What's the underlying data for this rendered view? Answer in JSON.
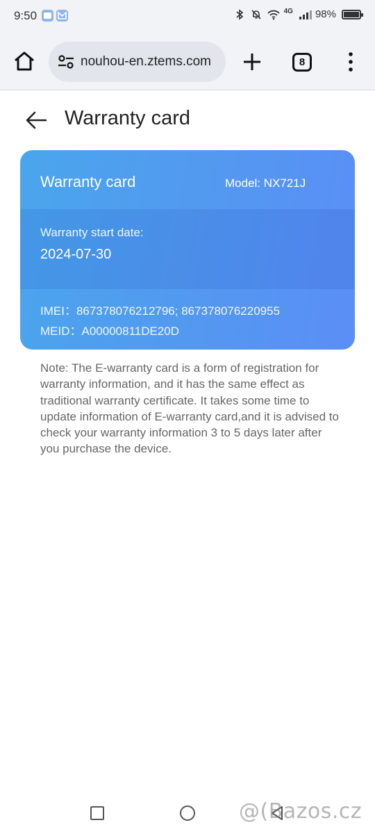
{
  "status_bar": {
    "time": "9:50",
    "network": "4G",
    "battery": "98%"
  },
  "browser": {
    "url": "nouhou-en.ztems.com",
    "tab_count": "8",
    "icons": [
      "home-icon",
      "site-settings-icon",
      "plus-icon",
      "tabs-icon",
      "more-vert-icon"
    ]
  },
  "page": {
    "title": "Warranty card"
  },
  "card": {
    "title": "Warranty card",
    "model": "Model: NX721J",
    "start_label": "Warranty start date:",
    "start_date": "2024-07-30",
    "imei": "IMEI：867378076212796; 867378076220955",
    "meid": "MEID：A00000811DE20D",
    "colors": {
      "gradient_start": "#4aa6ec",
      "gradient_end": "#5b8ef6"
    }
  },
  "note": "Note: The E-warranty card is a form of registration for warranty information, and it has the same effect as traditional warranty certificate. It takes some time to update information of E-warranty card,and it is advised to check your warranty information 3 to 5 days later after you purchase the device.",
  "watermark": "@(Bazos.cz"
}
